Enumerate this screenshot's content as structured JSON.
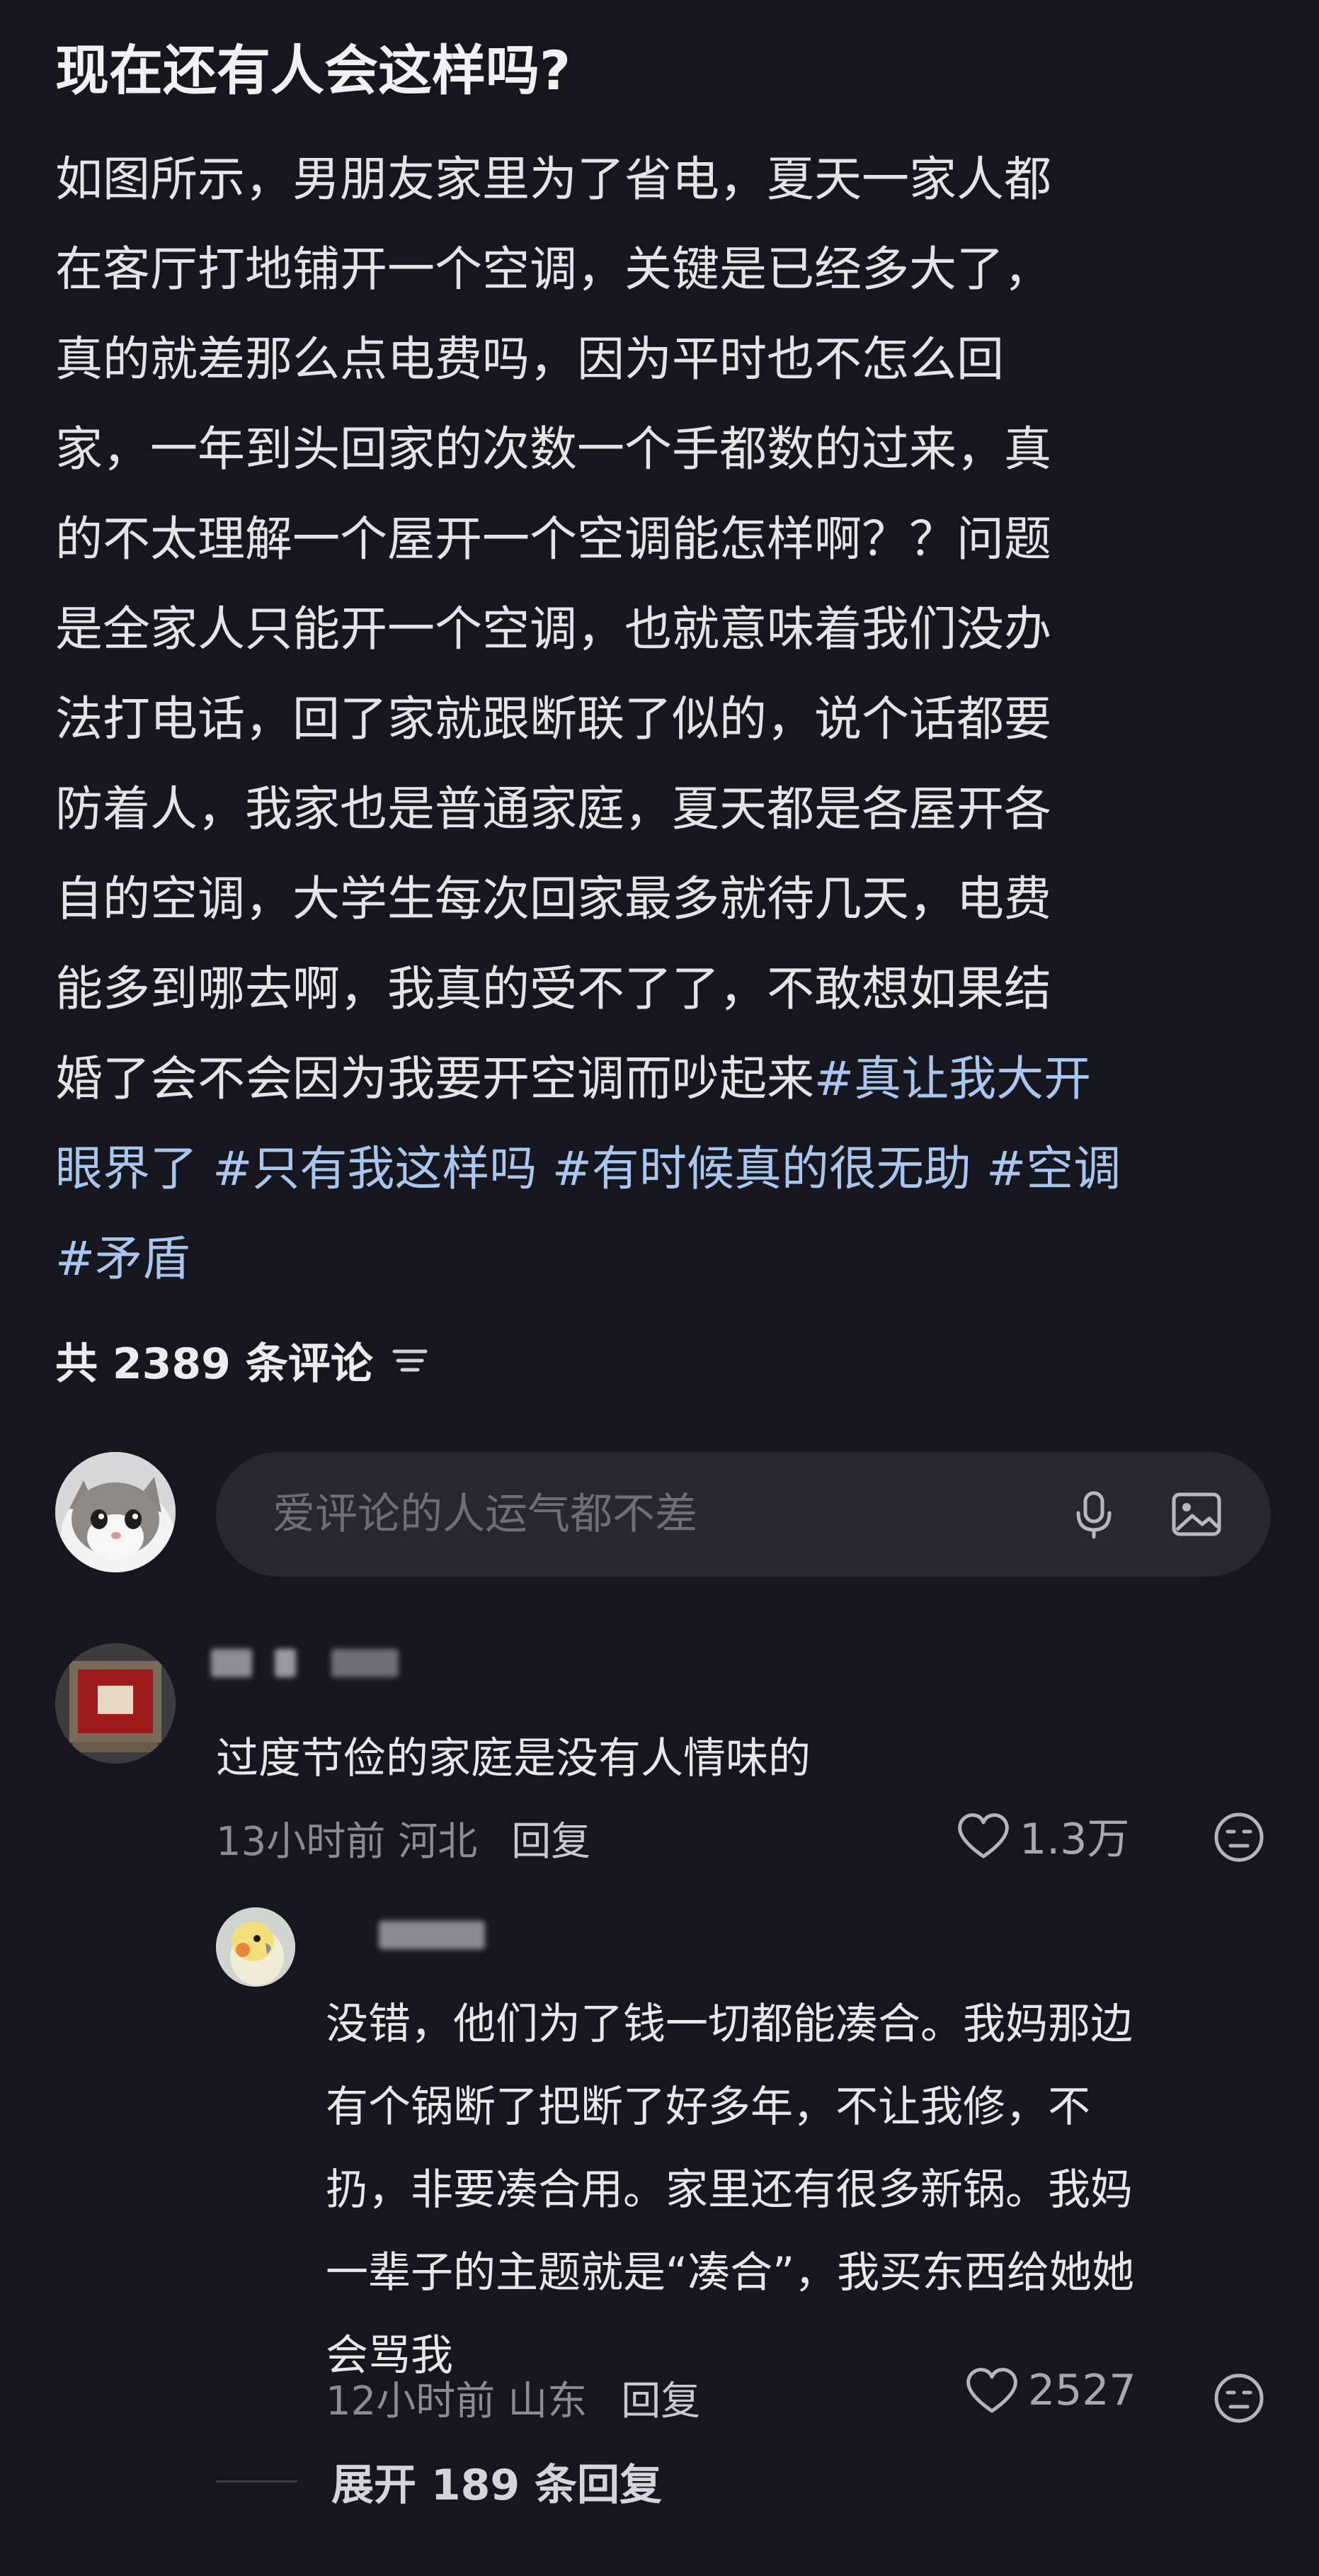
{
  "post": {
    "title": "现在还有人会这样吗?",
    "body_lines": [
      {
        "text": "如图所示，男朋友家里为了省电，夏天一家人都",
        "tags": ""
      },
      {
        "text": "在客厅打地铺开一个空调，关键是已经多大了，",
        "tags": ""
      },
      {
        "text": "真的就差那么点电费吗，因为平时也不怎么回",
        "tags": ""
      },
      {
        "text": "家，一年到头回家的次数一个手都数的过来，真",
        "tags": ""
      },
      {
        "text": "的不太理解一个屋开一个空调能怎样啊？？问题",
        "tags": ""
      },
      {
        "text": "是全家人只能开一个空调，也就意味着我们没办",
        "tags": ""
      },
      {
        "text": "法打电话，回了家就跟断联了似的，说个话都要",
        "tags": ""
      },
      {
        "text": "防着人，我家也是普通家庭，夏天都是各屋开各",
        "tags": ""
      },
      {
        "text": "自的空调，大学生每次回家最多就待几天，电费",
        "tags": ""
      },
      {
        "text": "能多到哪去啊，我真的受不了了，不敢想如果结",
        "tags": ""
      },
      {
        "text": "婚了会不会因为我要开空调而吵起来",
        "tags": "#真让我大开"
      },
      {
        "text": "",
        "tags": "眼界了 #只有我这样吗 #有时候真的很无助 #空调"
      },
      {
        "text": "",
        "tags": "#矛盾"
      }
    ]
  },
  "comments_header": {
    "count_label": "共 2389 条评论",
    "sort_icon": "sort-lines-icon"
  },
  "composer": {
    "placeholder": "爱评论的人运气都不差",
    "voice_icon": "microphone-icon",
    "image_icon": "image-icon"
  },
  "comments": [
    {
      "text_lines": [
        "过度节俭的家庭是没有人情味的"
      ],
      "time": "13小时前",
      "location": "河北",
      "reply_label": "回复",
      "likes": "1.3万",
      "avatar_icon": "framed-picture-avatar",
      "replies": [
        {
          "text_lines": [
            "没错，他们为了钱一切都能凑合。我妈那边",
            "有个锅断了把断了好多年，不让我修，不",
            "扔，非要凑合用。家里还有很多新锅。我妈",
            "一辈子的主题就是“凑合”，我买东西给她她",
            "会骂我"
          ],
          "time": "12小时前",
          "location": "山东",
          "reply_label": "回复",
          "likes": "2527",
          "avatar_icon": "parrot-avatar"
        }
      ],
      "expand_label": "展开 189 条回复"
    }
  ],
  "colors": {
    "background": "#16161e",
    "hashtag": "#a9c6ef",
    "composer_bg": "#272730"
  }
}
